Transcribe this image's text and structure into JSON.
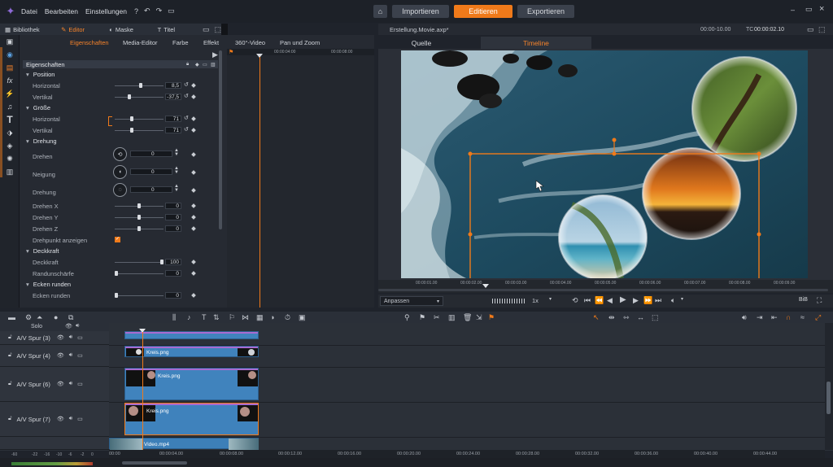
{
  "app": {
    "menu": [
      "Datei",
      "Bearbeiten",
      "Einstellungen"
    ],
    "modes": [
      "Importieren",
      "Editieren",
      "Exportieren"
    ],
    "active_mode": "Editieren"
  },
  "left_panel": {
    "tabs": [
      "Bibliothek",
      "Editor",
      "Maske",
      "Titel"
    ],
    "active_tab": "Editor",
    "subtabs": [
      "Eigenschaften",
      "Media-Editor",
      "Farbe",
      "Effekt",
      "360°-Video",
      "Pan und Zoom"
    ],
    "active_subtab": "Eigenschaften",
    "props_header": "Eigenschaften",
    "sections": {
      "position": "Position",
      "groesse": "Größe",
      "drehung": "Drehung",
      "deckkraft": "Deckkraft",
      "ecken": "Ecken runden"
    },
    "labels": {
      "horizontal": "Horizontal",
      "vertikal": "Vertikal",
      "drehen": "Drehen",
      "neigung": "Neigung",
      "drehung": "Drehung",
      "drehen_x": "Drehen X",
      "drehen_y": "Drehen Y",
      "drehen_z": "Drehen Z",
      "drehpunkt": "Drehpunkt anzeigen",
      "deckkraft": "Deckkraft",
      "randunschaerfe": "Randunschärfe",
      "ecken_runden": "Ecken runden"
    },
    "values": {
      "pos_h": "8,5",
      "pos_v": "-37,5",
      "size_h": "71",
      "size_v": "71",
      "drehen": "0",
      "neigung": "0",
      "drehung": "0",
      "drehen_x": "0",
      "drehen_y": "0",
      "drehen_z": "0",
      "deckkraft": "100",
      "randunschaerfe": "0",
      "ecken_runden": "0"
    },
    "slider_levels": {
      "pos_h": 0.54,
      "pos_v": 0.3,
      "size_h": 0.35,
      "size_v": 0.35,
      "drehen_x": 0.5,
      "drehen_y": 0.5,
      "drehen_z": 0.5,
      "deckkraft": 1.0,
      "randunschaerfe": 0.0,
      "ecken_runden": 0.0
    },
    "drehpunkt_checked": true,
    "kf_ruler": [
      "00:00:04:00",
      "00:00:08:00"
    ]
  },
  "preview": {
    "file": "Erstellung.Movie.axp*",
    "timecode_range": "00:00-10.00",
    "tc_label": "TC",
    "tc_value": "00:00:02.10",
    "tabs": [
      "Quelle",
      "Timeline"
    ],
    "active_tab": "Timeline",
    "ruler": [
      "00:00:01.00",
      "00:00:02.00",
      "00:00:03.00",
      "00:00:04.00",
      "00:00:05.00",
      "00:00:06.00",
      "00:00:07.00",
      "00:00:08.00",
      "00:00:09.00"
    ],
    "fit_label": "Anpassen",
    "speed": "1x",
    "pip_label": "BiB"
  },
  "timeline": {
    "solo_label": "Solo",
    "tracks": [
      "A/V Spur (3)",
      "A/V Spur (4)",
      "A/V Spur (6)",
      "A/V Spur (7)"
    ],
    "clips": [
      "Kreis.png",
      "Kreis.png",
      "Kreis.png",
      "Video.mp4"
    ],
    "ruler": [
      "00:00",
      "00:00:04.00",
      "00:00:08.00",
      "00:00:12.00",
      "00:00:16.00",
      "00:00:20.00",
      "00:00:24.00",
      "00:00:28.00",
      "00:00:32.00",
      "00:00:36.00",
      "00:00:40.00",
      "00:00:44.00"
    ],
    "meter_scale": [
      "-60",
      "-22",
      "-16",
      "-10",
      "-6",
      "-2",
      "0"
    ]
  },
  "colors": {
    "accent": "#f07a1a",
    "clip": "#4083bd",
    "bg": "#1f232b"
  }
}
